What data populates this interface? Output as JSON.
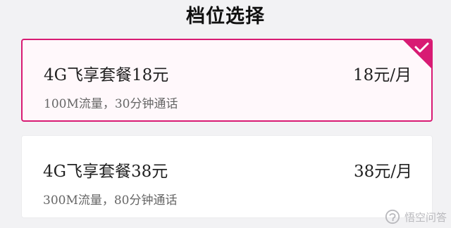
{
  "page": {
    "title": "档位选择"
  },
  "plans": [
    {
      "name": "4G飞享套餐18元",
      "price": "18元/月",
      "description": "100M流量，30分钟通话",
      "selected": true
    },
    {
      "name": "4G飞享套餐38元",
      "price": "38元/月",
      "description": "300M流量，80分钟通话",
      "selected": false
    }
  ],
  "watermark": {
    "text": "悟空问答"
  },
  "colors": {
    "accent": "#d81b73",
    "background": "#f2f2f4",
    "card": "#ffffff"
  }
}
